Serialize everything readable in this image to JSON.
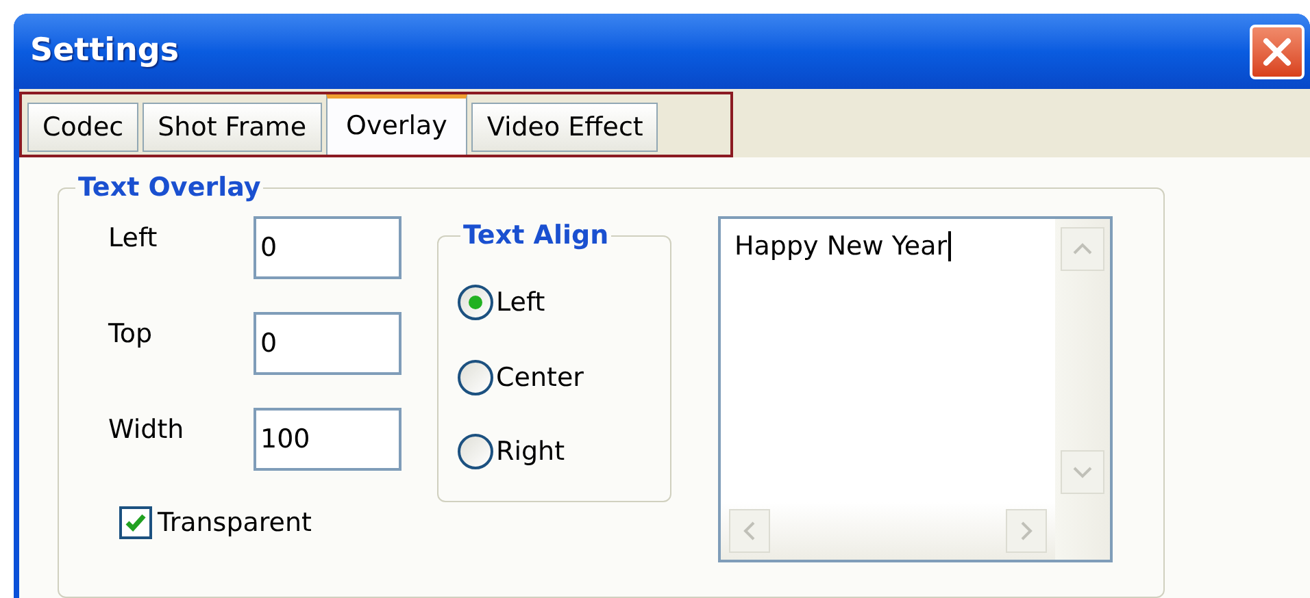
{
  "window": {
    "title": "Settings"
  },
  "tabs": [
    {
      "label": "Codec",
      "selected": false
    },
    {
      "label": "Shot Frame",
      "selected": false
    },
    {
      "label": "Overlay",
      "selected": true
    },
    {
      "label": "Video Effect",
      "selected": false
    }
  ],
  "text_overlay": {
    "title": "Text Overlay",
    "fields": [
      {
        "label": "Left",
        "value": "0"
      },
      {
        "label": "Top",
        "value": "0"
      },
      {
        "label": "Width",
        "value": "100"
      }
    ],
    "text_align": {
      "title": "Text Align",
      "options": [
        {
          "label": "Left",
          "selected": true
        },
        {
          "label": "Center",
          "selected": false
        },
        {
          "label": "Right",
          "selected": false
        }
      ]
    },
    "text": {
      "value": "Happy New Year"
    },
    "transparent": {
      "label": "Transparent",
      "checked": true
    }
  }
}
